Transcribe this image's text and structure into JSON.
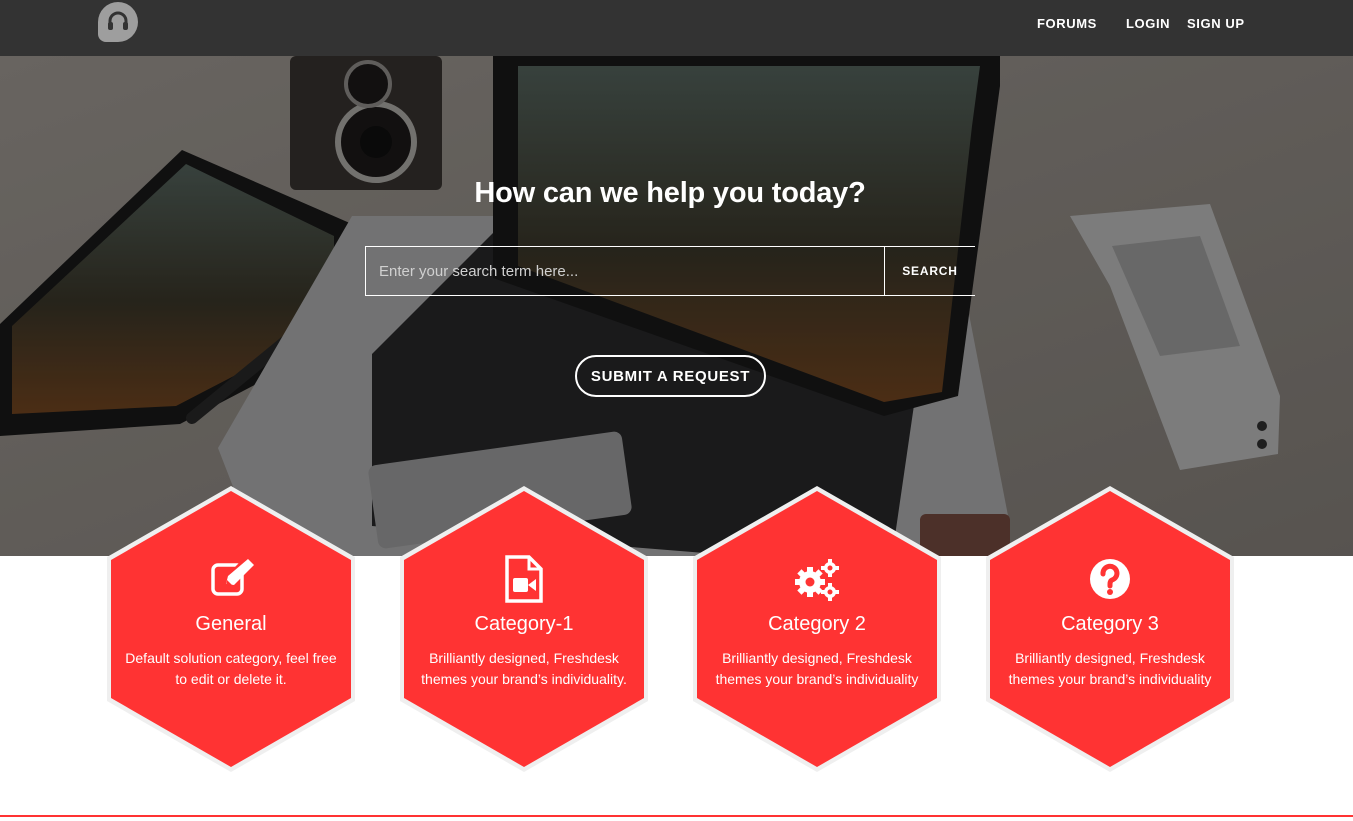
{
  "brand": {
    "accent": "#ff3333",
    "topbar_bg": "#333333"
  },
  "header": {
    "logo_icon": "headset-icon",
    "nav": {
      "forums": "FORUMS",
      "login": "LOGIN",
      "signup": "SIGN UP"
    }
  },
  "hero": {
    "title": "How can we help you today?",
    "search": {
      "placeholder": "Enter your search term here...",
      "button": "SEARCH"
    },
    "submit_request": "SUBMIT A REQUEST"
  },
  "categories": [
    {
      "icon": "edit-icon",
      "title": "General",
      "desc": "Default solution category, feel free to edit or delete it."
    },
    {
      "icon": "video-file-icon",
      "title": "Category-1",
      "desc": "Brilliantly designed, Freshdesk themes your brand’s individuality."
    },
    {
      "icon": "gears-icon",
      "title": "Category 2",
      "desc": "Brilliantly designed, Freshdesk themes your brand’s individuality"
    },
    {
      "icon": "question-circle-icon",
      "title": "Category 3",
      "desc": "Brilliantly designed, Freshdesk themes your brand’s individuality"
    }
  ]
}
